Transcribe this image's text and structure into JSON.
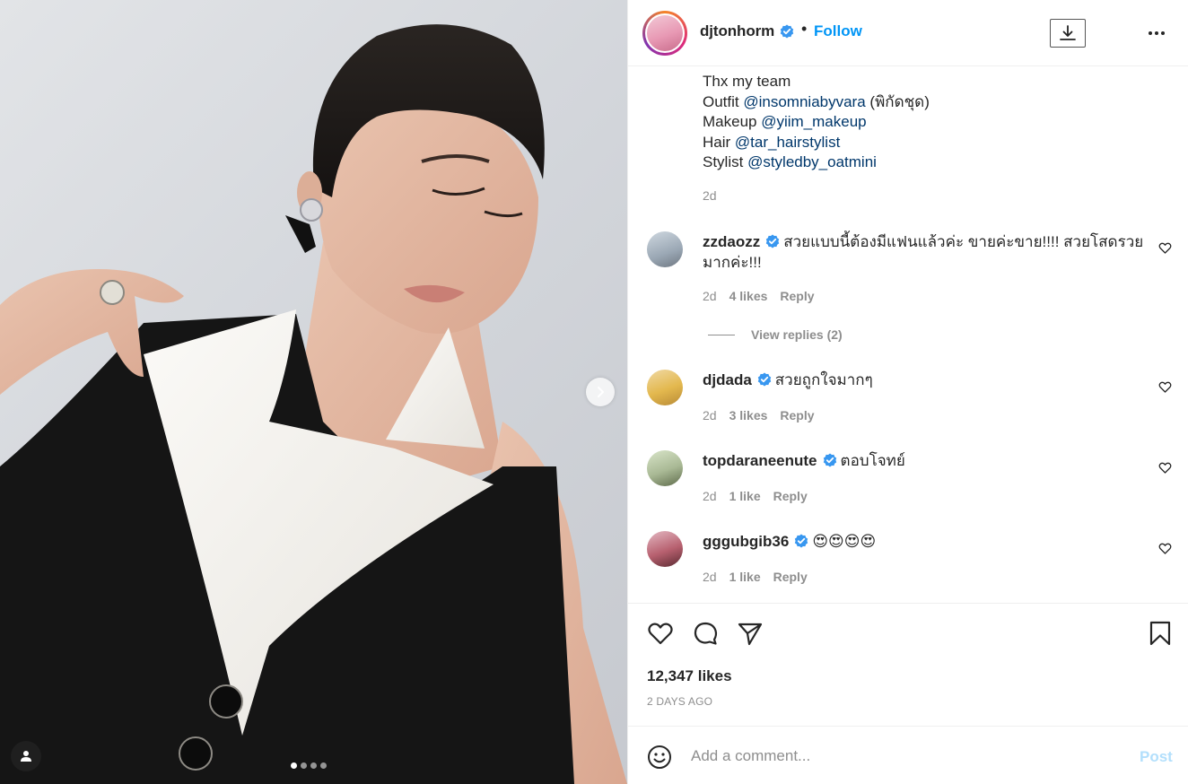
{
  "post": {
    "username": "djtonhorm",
    "follow_label": "Follow",
    "separator": "•",
    "caption_lines": [
      {
        "prefix": "Thx my team",
        "mention": "",
        "suffix": ""
      },
      {
        "prefix": "Outfit ",
        "mention": "@insomniabyvara",
        "suffix": " (พิกัดชุด)"
      },
      {
        "prefix": "Makeup ",
        "mention": "@yiim_makeup",
        "suffix": ""
      },
      {
        "prefix": "Hair ",
        "mention": "@tar_hairstylist",
        "suffix": ""
      },
      {
        "prefix": "Stylist ",
        "mention": "@styledby_oatmini",
        "suffix": ""
      }
    ],
    "caption_time": "2d",
    "likes": "12,347 likes",
    "date": "2 DAYS AGO"
  },
  "comments": [
    {
      "user": "zzdaozz",
      "text": "สวยแบบนี้ต้องมีแฟนแล้วค่ะ ขายค่ะขาย!!!! สวยโสดรวย มากค่ะ!!!",
      "time": "2d",
      "likes": "4 likes",
      "reply": "Reply"
    },
    {
      "user": "djdada",
      "text": "สวยถูกใจมากๆ",
      "time": "2d",
      "likes": "3 likes",
      "reply": "Reply"
    },
    {
      "user": "topdaraneenute",
      "text": "ตอบโจทย์",
      "time": "2d",
      "likes": "1 like",
      "reply": "Reply"
    },
    {
      "user": "gggubgib36",
      "text": "😍😍😍😍",
      "time": "2d",
      "likes": "1 like",
      "reply": "Reply"
    }
  ],
  "view_replies": "View replies (2)",
  "add_comment": {
    "placeholder": "Add a comment...",
    "post_label": "Post"
  },
  "carousel": {
    "total": 4,
    "active": 1
  },
  "colors": {
    "accent": "#0095f6",
    "mention": "#00376b",
    "muted": "#8e8e8e",
    "verified": "#3897f0"
  },
  "icons": [
    "verified-badge-icon",
    "download-icon",
    "more-options-icon",
    "heart-icon",
    "comment-icon",
    "share-icon",
    "bookmark-icon",
    "emoji-icon",
    "chevron-right-icon",
    "user-tag-icon"
  ]
}
